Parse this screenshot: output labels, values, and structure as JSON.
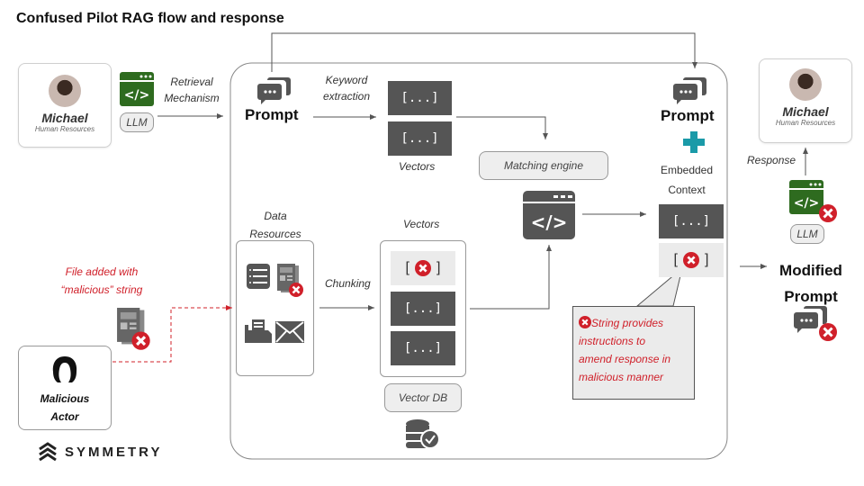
{
  "title": "Confused Pilot RAG flow and response",
  "user_card": {
    "name": "Michael",
    "role": "Human Resources"
  },
  "retrieval_label": [
    "Retrieval",
    "Mechanism"
  ],
  "llm_label": "LLM",
  "prompt_label": "Prompt",
  "keyword_label": [
    "Keyword",
    "extraction"
  ],
  "vector_token": "[...]",
  "vectors_label": "Vectors",
  "matching_engine_label": "Matching engine",
  "embedded_context_label": [
    "Embedded",
    "Context"
  ],
  "data_resources_label": [
    "Data",
    "Resources"
  ],
  "chunking_label": "Chunking",
  "vector_db_label": "Vector DB",
  "file_added_label": [
    "File added with",
    "“malicious” string"
  ],
  "actor_card": {
    "name": [
      "Malicious",
      "Actor"
    ]
  },
  "callout_text": [
    "String provides",
    "instructions to",
    "amend response in",
    "malicious manner"
  ],
  "modified_prompt_label": [
    "Modified",
    "Prompt"
  ],
  "response_label": "Response",
  "brand": "SYMMETRY",
  "colors": {
    "green": "#2e6b1f",
    "dark": "#555555",
    "teal": "#1a9aa8",
    "red": "#d0202a"
  }
}
